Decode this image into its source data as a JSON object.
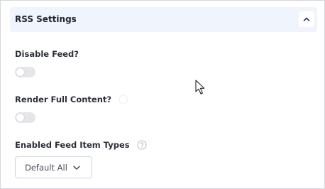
{
  "section": {
    "title": "RSS Settings",
    "collapse_icon": "chevron-up-icon"
  },
  "fields": {
    "disable_feed": {
      "label": "Disable Feed?",
      "enabled": false
    },
    "render_full_content": {
      "label": "Render Full Content?",
      "enabled": false,
      "help_icon": "question-circle-icon"
    },
    "enabled_feed_item_types": {
      "label": "Enabled Feed Item Types",
      "help_icon": "question-circle-icon",
      "selected_value": "Default All",
      "dropdown_icon": "chevron-down-icon"
    }
  },
  "colors": {
    "header_background": "#f0f4fd",
    "toggle_off": "#e4e6ea",
    "border": "#d5d7dd"
  }
}
